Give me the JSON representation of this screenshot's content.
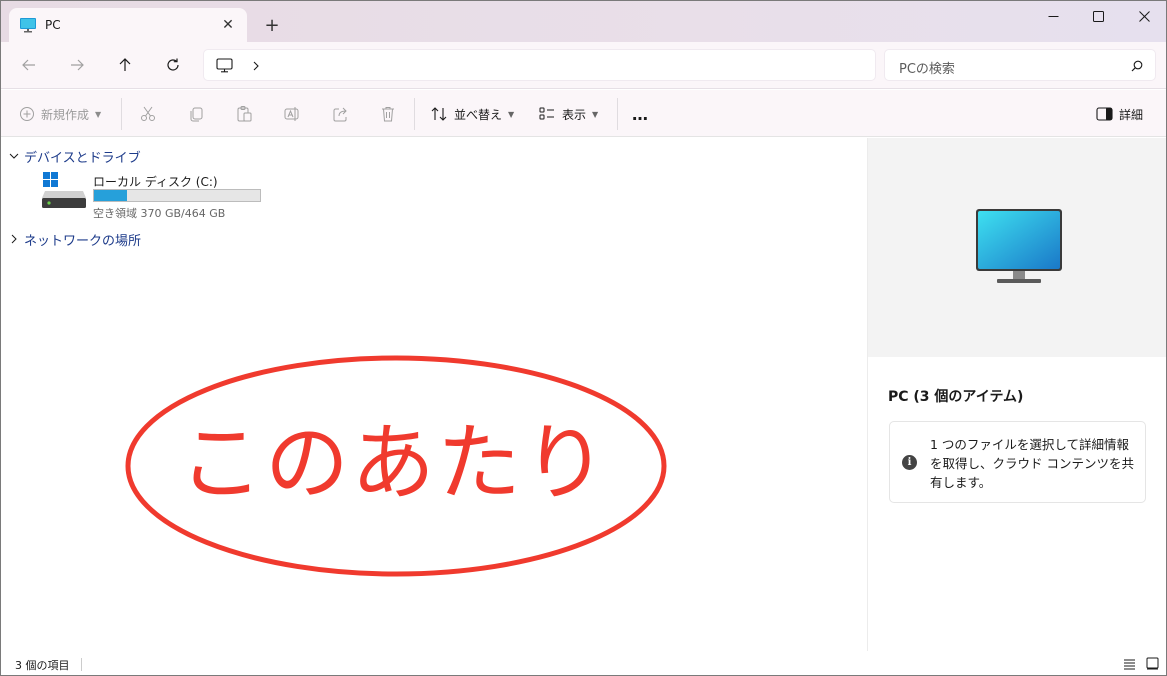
{
  "window": {
    "tab_title": "PC",
    "tab_icon": "pc-monitor-icon"
  },
  "navigation": {
    "search_placeholder": "PCの検索"
  },
  "commands": {
    "new_label": "新規作成",
    "sort_label": "並べ替え",
    "view_label": "表示",
    "more_label": "…",
    "details_label": "詳細"
  },
  "groups": [
    {
      "label": "デバイスとドライブ",
      "expanded": true,
      "items": [
        {
          "name": "ローカル ディスク (C:)",
          "free_text": "空き領域 370 GB/464 GB",
          "used_fraction": 0.2
        }
      ]
    },
    {
      "label": "ネットワークの場所",
      "expanded": false
    }
  ],
  "preview": {
    "title": "PC (3 個のアイテム)",
    "info_text": "1 つのファイルを選択して詳細情報を取得し、クラウド コンテンツを共有します。"
  },
  "status": {
    "item_count": "3 個の項目"
  },
  "annotation": {
    "text": "このあたり",
    "color": "#f03a2e"
  },
  "colors": {
    "accent": "#26a0da",
    "group_header": "#1d3b8a"
  }
}
